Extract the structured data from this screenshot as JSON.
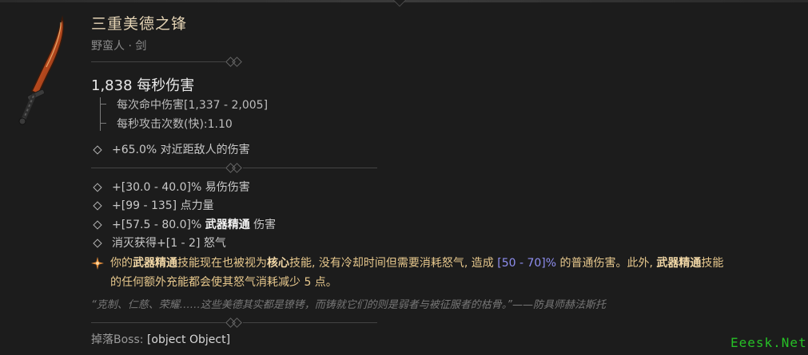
{
  "item": {
    "name": "三重美德之锋",
    "subtitle": "野蛮人 · 剑",
    "dps": "1,838 每秒伤害",
    "damage_per_hit": "每次命中伤害[1,337 - 2,005]",
    "attack_speed": "每秒攻击次数(快):1.10",
    "implicit": "+65.0% 对近距敌人的伤害",
    "affixes": [
      {
        "text": "+[30.0 - 40.0]% 易伤伤害"
      },
      {
        "text": "+[99 - 135] 点力量"
      },
      {
        "prefix": "+[57.5 - 80.0]% ",
        "bold": "武器精通",
        "suffix": " 伤害"
      },
      {
        "text": "消灭获得+[1 - 2] 怒气"
      }
    ],
    "legendary": {
      "p1": "你的",
      "b1": "武器精通",
      "p2": "技能现在也被视为",
      "b2": "核心",
      "p3": "技能, 没有冷却时间但需要消耗怒气, 造成 ",
      "range": "[50 - 70]%",
      "p4": " 的普通伤害。此外, ",
      "b3": "武器精通",
      "p5": "技能的任何额外充能都会使其怒气消耗减少 5 点。"
    },
    "flavor": "“克制、仁慈、荣耀……这些美德其实都是镣铐，而铸就它们的则是弱者与被征服者的枯骨。”——防具师赫法斯托",
    "boss_label": "掉落Boss:",
    "boss_value": "[object Object]"
  },
  "watermark": "Eeesk.Net",
  "colors": {
    "background": "#1c1c1c",
    "title": "#e6d5b6",
    "legendary": "#e7c88d",
    "range": "#8f8ff1"
  },
  "icons": {
    "weapon": "sword-icon",
    "legendary": "legendary-aspect-icon",
    "bullet": "diamond-bullet-icon"
  }
}
